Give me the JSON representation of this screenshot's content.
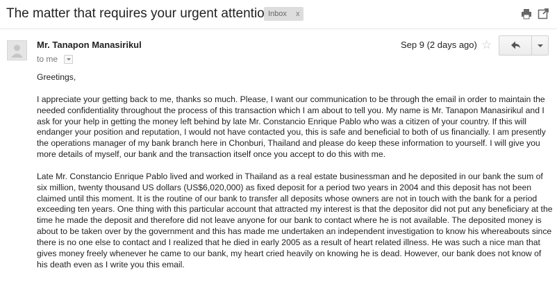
{
  "email": {
    "subject": "The matter that requires your urgent attention",
    "label": "Inbox",
    "label_remove": "x",
    "sender": "Mr. Tanapon Manasirikul",
    "to": "to me",
    "date": "Sep 9 (2 days ago)",
    "star": "☆",
    "greeting": "Greetings,",
    "paragraphs": [
      "I appreciate your getting back to me, thanks so much. Please, I want our communication to be through the email in order to maintain the needed confidentiality throughout the process of this transaction which I am about to tell you. My name is Mr. Tanapon Manasirikul and I ask for your help in getting the money left behind by late Mr. Constancio Enrique Pablo who was a citizen of your country. If this will endanger your position and reputation, I would not have contacted you, this is safe and beneficial to both of us financially. I am presently the operations manager of my bank branch here in Chonburi, Thailand and please do keep these information to yourself. I will give you more details of myself, our bank and the transaction itself once you accept to do this with me.",
      "Late Mr. Constancio Enrique Pablo lived and worked in Thailand as a real estate businessman and he deposited in our bank the sum of six million, twenty thousand US dollars (US$6,020,000) as fixed deposit for a period two years in 2004 and this deposit has not been claimed until this moment. It is the routine of our bank to transfer all deposits whose owners are not in touch with the bank for a period exceeding ten years. One thing with this particular account that attracted my interest is that the depositor did not put any beneficiary at the time he made the deposit and therefore did not leave anyone for our bank to contact where he is not available. The deposited money is about to be taken over by the government and this has made me undertaken an independent investigation to know his whereabouts since there is no one else to contact and I realized that he died in early 2005 as a result of heart related illness. He was such a nice man that gives money freely whenever he came to our bank, my heart cried heavily on knowing he is dead. However, our bank does not know of his death even as I write you this email."
    ]
  },
  "icons": {
    "print": "print-icon",
    "popout": "popout-icon",
    "avatar": "avatar-placeholder-icon",
    "reply": "reply-icon",
    "more": "dropdown-caret-icon"
  },
  "colors": {
    "label_chip_bg": "#dddddd",
    "button_border": "#d0d0d0",
    "muted_text": "#777777"
  }
}
